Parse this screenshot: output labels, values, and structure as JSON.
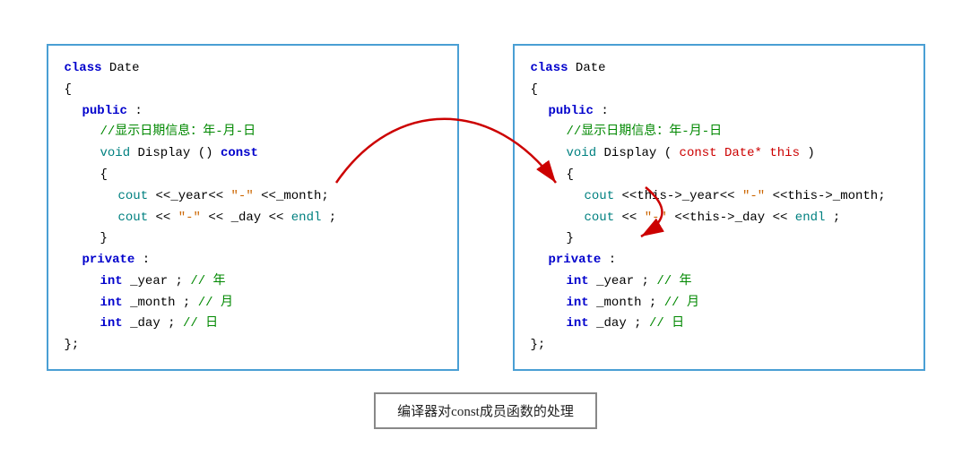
{
  "left_panel": {
    "lines": [
      {
        "type": "keyword-blue",
        "text": "class Date"
      },
      {
        "type": "brace",
        "text": "{"
      },
      {
        "type": "keyword-blue-indent1",
        "text": "public :"
      },
      {
        "type": "comment-indent2",
        "text": "//显示日期信息：年-月-日"
      },
      {
        "type": "method-indent2",
        "text": "void Display () const"
      },
      {
        "type": "brace-indent2",
        "text": "{"
      },
      {
        "type": "code-indent3",
        "text": "cout <<_year<< \"-\" <<_month;"
      },
      {
        "type": "code-indent3",
        "text": "cout << \"-\"<< _day <<endl;"
      },
      {
        "type": "brace-indent2",
        "text": "}"
      },
      {
        "type": "keyword-blue-indent1",
        "text": "private :"
      },
      {
        "type": "code-indent2",
        "text": "int _year ;  // 年"
      },
      {
        "type": "code-indent2",
        "text": "int _month ; // 月"
      },
      {
        "type": "code-indent2",
        "text": "int _day ;   // 日"
      },
      {
        "type": "brace",
        "text": "};"
      }
    ]
  },
  "right_panel": {
    "lines": [
      {
        "type": "keyword-blue",
        "text": "class Date"
      },
      {
        "type": "brace",
        "text": "{"
      },
      {
        "type": "keyword-blue-indent1",
        "text": "public :"
      },
      {
        "type": "comment-indent2",
        "text": "//显示日期信息：年-月-日"
      },
      {
        "type": "method-indent2-red",
        "text": "void Display (const Date* this)"
      },
      {
        "type": "brace-indent2",
        "text": "{"
      },
      {
        "type": "code-indent3",
        "text": "cout<<this->_year<<\"-\"<<this->_month;"
      },
      {
        "type": "code-indent3",
        "text": "cout <<\"-\"<<this->_day <<endl;"
      },
      {
        "type": "brace-indent2",
        "text": "}"
      },
      {
        "type": "keyword-blue-indent1",
        "text": "private :"
      },
      {
        "type": "code-indent2",
        "text": "int _year ;  // 年"
      },
      {
        "type": "code-indent2",
        "text": "int _month ; // 月"
      },
      {
        "type": "code-indent2",
        "text": "int _day ;   // 日"
      },
      {
        "type": "brace",
        "text": "};"
      }
    ]
  },
  "caption": "编译器对const成员函数的处理"
}
